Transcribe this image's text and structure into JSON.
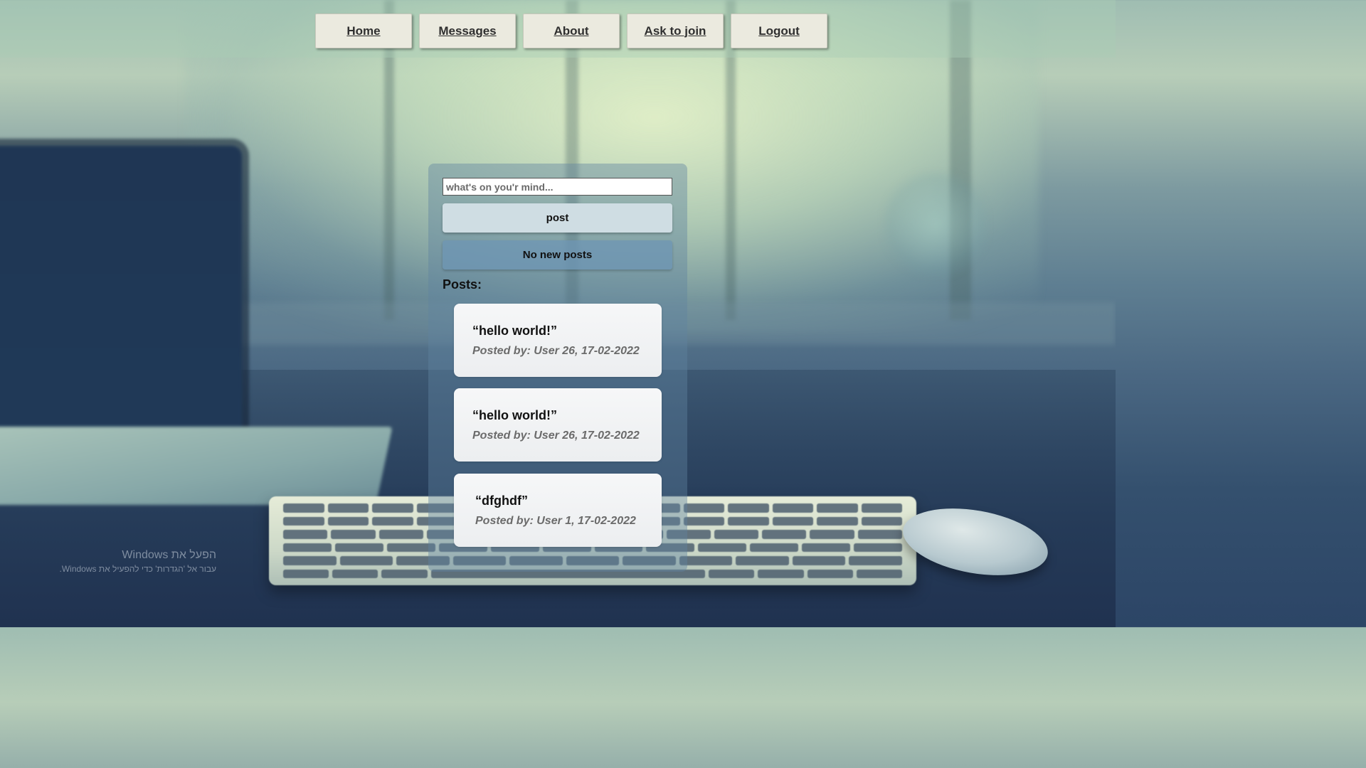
{
  "nav": {
    "items": [
      {
        "label": "Home"
      },
      {
        "label": "Messages"
      },
      {
        "label": "About"
      },
      {
        "label": "Ask to join"
      },
      {
        "label": "Logout"
      }
    ]
  },
  "composer": {
    "placeholder": "what's on you'r mind...",
    "post_label": "post"
  },
  "status": {
    "no_new_posts": "No new posts"
  },
  "posts_heading": "Posts:",
  "posts": [
    {
      "text": "“hello world!”",
      "meta": "Posted by: User 26, 17-02-2022"
    },
    {
      "text": "“hello world!”",
      "meta": "Posted by: User 26, 17-02-2022"
    },
    {
      "text": "“dfghdf”",
      "meta": "Posted by: User 1, 17-02-2022"
    }
  ],
  "watermark": {
    "title": "הפעל את Windows",
    "subtitle": "עבור אל 'הגדרות' כדי להפעיל את Windows."
  },
  "colors": {
    "nav_button_bg": "#ebeadf",
    "post_button_bg": "#cfdde3",
    "card_bg": "#f3f4f5"
  }
}
